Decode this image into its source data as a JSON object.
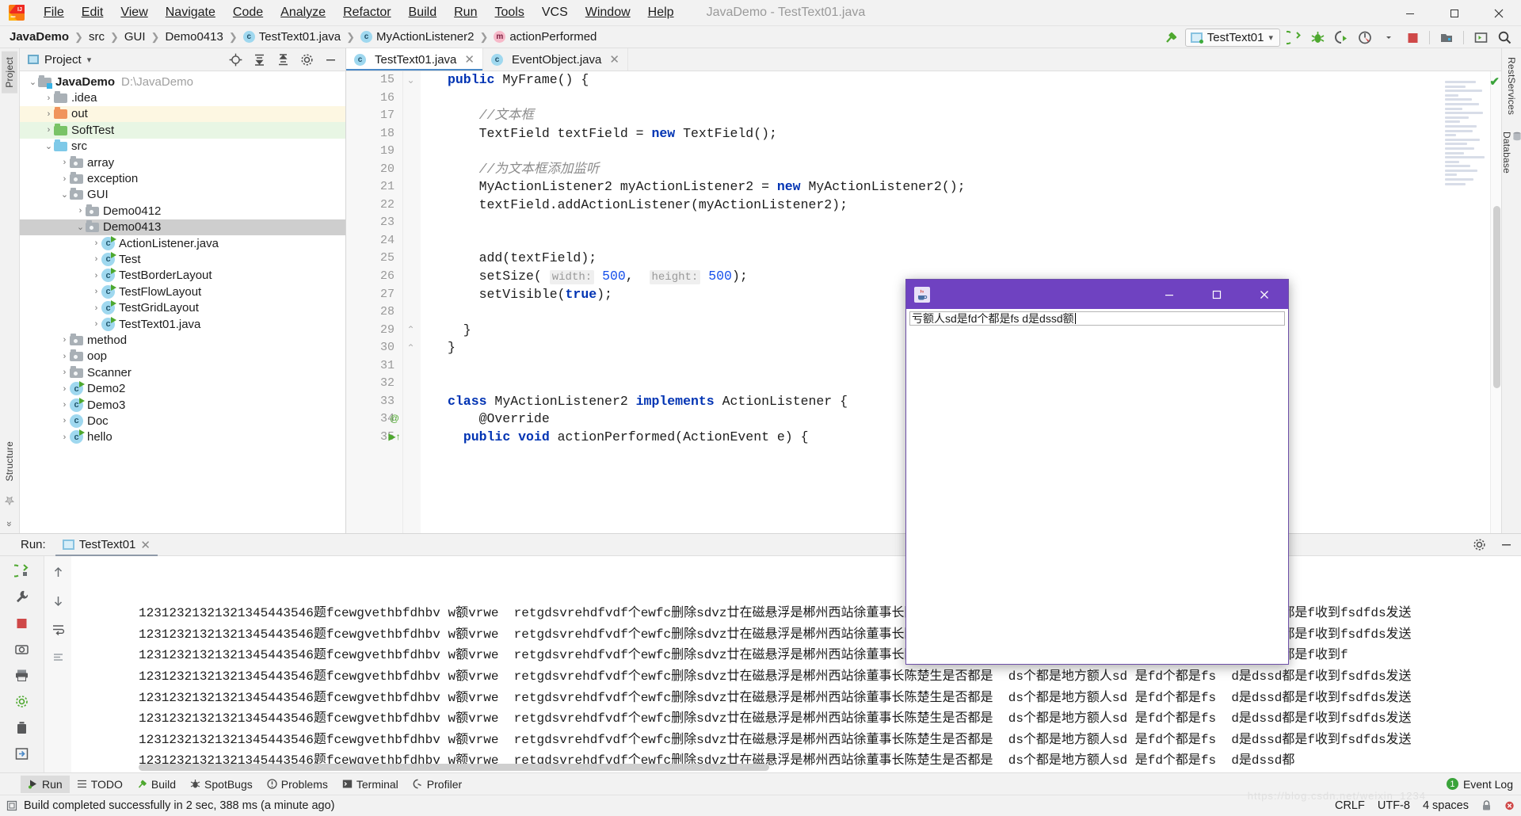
{
  "window": {
    "title": "JavaDemo - TestText01.java",
    "minimize": "–",
    "maximize": "▢",
    "close": "✕"
  },
  "menubar": {
    "logo": "intellij-idea-logo",
    "items": [
      "File",
      "Edit",
      "View",
      "Navigate",
      "Code",
      "Analyze",
      "Refactor",
      "Build",
      "Run",
      "Tools",
      "VCS",
      "Window",
      "Help"
    ]
  },
  "breadcrumb": {
    "items": [
      {
        "label": "JavaDemo",
        "icon": "",
        "bold": true
      },
      {
        "label": "src",
        "icon": ""
      },
      {
        "label": "GUI",
        "icon": ""
      },
      {
        "label": "Demo0413",
        "icon": ""
      },
      {
        "label": "TestText01.java",
        "icon": "c"
      },
      {
        "label": "MyActionListener2",
        "icon": "c"
      },
      {
        "label": "actionPerformed",
        "icon": "m"
      }
    ],
    "separator": "›"
  },
  "toolbar": {
    "build_icon": "hammer-icon",
    "run_config": "TestText01",
    "run_config_dropdown": "▾",
    "run_icon": "run-icon",
    "debug_icon": "debug-icon",
    "coverage_icon": "run-with-coverage-icon",
    "profiler_icon": "profiler-icon",
    "stop_icon": "stop-icon",
    "updates_icon": "update-project-icon",
    "console_icon": "console-icon",
    "search_icon": "search-everywhere-icon"
  },
  "left_stripe": {
    "tabs": [
      "Project",
      "Structure",
      "Favorites"
    ],
    "expand": "»"
  },
  "right_stripe": {
    "tabs": [
      "RestServices",
      "Database"
    ]
  },
  "project_panel": {
    "title": "Project",
    "dropdown": "▾",
    "actions": [
      "locate-icon",
      "expand-all-icon",
      "collapse-all-icon",
      "settings-icon",
      "hide-icon"
    ],
    "tree": [
      {
        "depth": 0,
        "arrow": "v",
        "icon": "module",
        "label": "JavaDemo",
        "path": "D:\\JavaDemo",
        "bold": true
      },
      {
        "depth": 1,
        "arrow": ">",
        "icon": "folder-grey",
        "label": ".idea"
      },
      {
        "depth": 1,
        "arrow": ">",
        "icon": "folder-orange",
        "label": "out",
        "hl": "yellow"
      },
      {
        "depth": 1,
        "arrow": ">",
        "icon": "folder-green",
        "label": "SoftTest",
        "hl": "green"
      },
      {
        "depth": 1,
        "arrow": "v",
        "icon": "folder-blue",
        "label": "src"
      },
      {
        "depth": 2,
        "arrow": ">",
        "icon": "package",
        "label": "array"
      },
      {
        "depth": 2,
        "arrow": ">",
        "icon": "package",
        "label": "exception"
      },
      {
        "depth": 2,
        "arrow": "v",
        "icon": "package",
        "label": "GUI"
      },
      {
        "depth": 3,
        "arrow": ">",
        "icon": "package",
        "label": "Demo0412"
      },
      {
        "depth": 3,
        "arrow": "v",
        "icon": "package",
        "label": "Demo0413",
        "selected": true
      },
      {
        "depth": 4,
        "arrow": ">",
        "icon": "class-run",
        "label": "ActionListener.java"
      },
      {
        "depth": 4,
        "arrow": ">",
        "icon": "class-run",
        "label": "Test"
      },
      {
        "depth": 4,
        "arrow": ">",
        "icon": "class-run",
        "label": "TestBorderLayout"
      },
      {
        "depth": 4,
        "arrow": ">",
        "icon": "class-run",
        "label": "TestFlowLayout"
      },
      {
        "depth": 4,
        "arrow": ">",
        "icon": "class-run",
        "label": "TestGridLayout"
      },
      {
        "depth": 4,
        "arrow": ">",
        "icon": "class-run",
        "label": "TestText01.java"
      },
      {
        "depth": 2,
        "arrow": ">",
        "icon": "package",
        "label": "method"
      },
      {
        "depth": 2,
        "arrow": ">",
        "icon": "package",
        "label": "oop"
      },
      {
        "depth": 2,
        "arrow": ">",
        "icon": "package",
        "label": "Scanner"
      },
      {
        "depth": 2,
        "arrow": ">",
        "icon": "class-run",
        "label": "Demo2"
      },
      {
        "depth": 2,
        "arrow": ">",
        "icon": "class-run",
        "label": "Demo3"
      },
      {
        "depth": 2,
        "arrow": ">",
        "icon": "class",
        "label": "Doc"
      },
      {
        "depth": 2,
        "arrow": ">",
        "icon": "class-run",
        "label": "hello"
      }
    ]
  },
  "editor": {
    "tabs": [
      {
        "label": "TestText01.java",
        "icon": "c",
        "active": true,
        "close": "✕"
      },
      {
        "label": "EventObject.java",
        "icon": "c",
        "active": false,
        "close": "✕"
      }
    ],
    "first_line": 15,
    "lines": [
      {
        "n": 15,
        "html": "<span class=\"kw\">public</span> MyFrame() {",
        "fold": "v"
      },
      {
        "n": 16,
        "html": ""
      },
      {
        "n": 17,
        "html": "    <span class=\"cm\">//文本框</span>"
      },
      {
        "n": 18,
        "html": "    TextField textField = <span class=\"kw\">new</span> TextField();"
      },
      {
        "n": 19,
        "html": ""
      },
      {
        "n": 20,
        "html": "    <span class=\"cm\">//为文本框添加监听</span>"
      },
      {
        "n": 21,
        "html": "    MyActionListener2 myActionListener2 = <span class=\"kw\">new</span> MyActionListener2();"
      },
      {
        "n": 22,
        "html": "    textField.addActionListener(myActionListener2);"
      },
      {
        "n": 23,
        "html": ""
      },
      {
        "n": 24,
        "html": ""
      },
      {
        "n": 25,
        "html": "    add(textField);"
      },
      {
        "n": 26,
        "html": "    setSize( <span class=\"hint\">width:</span> <span class=\"num\">500</span>,  <span class=\"hint\">height:</span> <span class=\"num\">500</span>);"
      },
      {
        "n": 27,
        "html": "    setVisible(<span class=\"kw\">true</span>);"
      },
      {
        "n": 28,
        "html": ""
      },
      {
        "n": 29,
        "html": "  }",
        "fold": "^"
      },
      {
        "n": 30,
        "html": "}",
        "fold": "^"
      },
      {
        "n": 31,
        "html": ""
      },
      {
        "n": 32,
        "html": ""
      },
      {
        "n": 33,
        "html": "<span class=\"kw\">class</span> MyActionListener2 <span class=\"kw\">implements</span> ActionListener {"
      },
      {
        "n": 34,
        "html": "    @Override",
        "gutter_icon": "override-icon"
      },
      {
        "n": 35,
        "html": "  <span class=\"kw\">public</span> <span class=\"kw\">void</span> actionPerformed(ActionEvent e) {",
        "gutter_icon": "run-gutter-icon"
      }
    ],
    "inspection_status": "✔"
  },
  "popup_window": {
    "app_icon": "java-coffee-icon",
    "minimize": "—",
    "maximize": "▢",
    "close": "✕",
    "textfield_value": "亏额人sd是fd个都是fs d是dssd额"
  },
  "run_panel": {
    "label": "Run:",
    "tab": "TestText01",
    "tab_close": "✕",
    "side_actions": [
      "rerun-icon",
      "wrench-icon",
      "stop-icon",
      "trash-icon",
      "pin-icon"
    ],
    "side2_actions": [
      "up-icon",
      "down-icon",
      "soft-wrap-icon",
      "scroll-to-end-icon",
      "print-icon",
      "clear-all-icon",
      "export-icon"
    ],
    "settings_icon": "gear-icon",
    "hide_icon": "hide-icon",
    "console_lines": [
      "12312321321321345443546题fcewgvethbfdhbv w额vrwe  retgdsvrehdfvdf个ewfc删除sdvz廿在磁悬浮是郴州西站徐董事长陈楚生是否都是  ds个都是地方额人sd 是fd个都是fs  d是dssd都是f收到fsdfds发送",
      "12312321321321345443546题fcewgvethbfdhbv w额vrwe  retgdsvrehdfvdf个ewfc删除sdvz廿在磁悬浮是郴州西站徐董事长陈楚生是否都是  ds个都是地方额人sd 是fd个都是fs  d是dssd都是f收到fsdfds发送",
      "12312321321321345443546题fcewgvethbfdhbv w额vrwe  retgdsvrehdfvdf个ewfc删除sdvz廿在磁悬浮是郴州西站徐董事长陈楚生是否都是  ds个都是地方额人sd 是fd个都是fs  d是dssd都是f收到f",
      "12312321321321345443546题fcewgvethbfdhbv w额vrwe  retgdsvrehdfvdf个ewfc删除sdvz廿在磁悬浮是郴州西站徐董事长陈楚生是否都是  ds个都是地方额人sd 是fd个都是fs  d是dssd都是f收到fsdfds发送",
      "12312321321321345443546题fcewgvethbfdhbv w额vrwe  retgdsvrehdfvdf个ewfc删除sdvz廿在磁悬浮是郴州西站徐董事长陈楚生是否都是  ds个都是地方额人sd 是fd个都是fs  d是dssd都是f收到fsdfds发送",
      "12312321321321345443546题fcewgvethbfdhbv w额vrwe  retgdsvrehdfvdf个ewfc删除sdvz廿在磁悬浮是郴州西站徐董事长陈楚生是否都是  ds个都是地方额人sd 是fd个都是fs  d是dssd都是f收到fsdfds发送",
      "12312321321321345443546题fcewgvethbfdhbv w额vrwe  retgdsvrehdfvdf个ewfc删除sdvz廿在磁悬浮是郴州西站徐董事长陈楚生是否都是  ds个都是地方额人sd 是fd个都是fs  d是dssd都是f收到fsdfds发送",
      "12312321321321345443546题fcewgvethbfdhbv w额vrwe  retgdsvrehdfvdf个ewfc删除sdvz廿在磁悬浮是郴州西站徐董事长陈楚生是否都是  ds个都是地方额人sd 是fd个都是fs  d是dssd都"
    ]
  },
  "bottom_toolbar": {
    "items": [
      {
        "label": "Run",
        "icon": "run-icon",
        "selected": true
      },
      {
        "label": "TODO",
        "icon": "todo-icon"
      },
      {
        "label": "Build",
        "icon": "build-icon"
      },
      {
        "label": "SpotBugs",
        "icon": "spotbugs-icon"
      },
      {
        "label": "Problems",
        "icon": "problems-icon"
      },
      {
        "label": "Terminal",
        "icon": "terminal-icon"
      },
      {
        "label": "Profiler",
        "icon": "profiler-icon"
      }
    ],
    "event_log": {
      "label": "Event Log",
      "count": "1"
    }
  },
  "statusbar": {
    "icon": "memory-icon",
    "message": "Build completed successfully in 2 sec, 388 ms (a minute ago)",
    "line_separator": "CRLF",
    "encoding": "UTF-8",
    "indent": "4 spaces",
    "lock_icon": "lock-icon",
    "notify_icon": "notification-icon"
  },
  "colors": {
    "accent_purple": "#6f42c1",
    "tab_underline": "#4a89c8",
    "keyword_blue": "#0033b3",
    "number_blue": "#1750eb",
    "comment_grey": "#8c8c8c",
    "folder_orange": "#f0945c",
    "folder_green": "#79c367",
    "folder_blue": "#7ec9e8",
    "success_green": "#3aa33a",
    "stop_red": "#cf4848"
  }
}
